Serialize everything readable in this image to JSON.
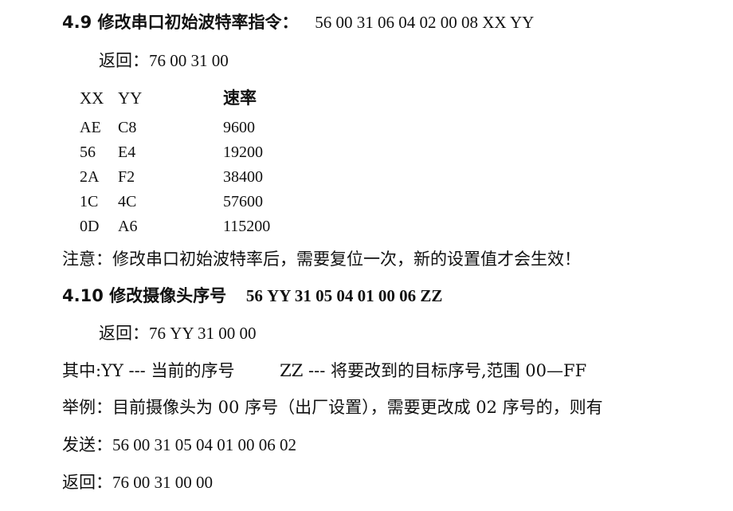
{
  "s49": {
    "title": "4.9 修改串口初始波特率指令：",
    "cmd": "56 00 31 06 04 02 00 08 XX  YY",
    "return_label": "返回：",
    "return_val": "76 00 31 00",
    "table": {
      "headers": [
        "XX",
        "YY",
        "速率"
      ],
      "rows": [
        [
          "AE",
          "C8",
          "9600"
        ],
        [
          "56",
          "E4",
          "19200"
        ],
        [
          "2A",
          "F2",
          "38400"
        ],
        [
          "1C",
          "4C",
          "57600"
        ],
        [
          "0D",
          "A6",
          "115200"
        ]
      ]
    },
    "note": "注意：修改串口初始波特率后，需要复位一次，新的设置值才会生效！"
  },
  "s410": {
    "title": "4.10 修改摄像头序号",
    "cmd": "56 YY 31 05 04 01 00 06 ZZ",
    "return_label": "返回：",
    "return_val": "76 YY 31 00 00",
    "explain_a": "其中:YY  --- 当前的序号",
    "explain_b": "ZZ  --- 将要改到的目标序号,范围 00—FF",
    "example": "举例：目前摄像头为 00 序号（出厂设置），需要更改成 02 序号的，则有",
    "send_label": "发送：",
    "send_val": "56 00 31 05 04 01 00 06 02",
    "ret2_label": "返回：",
    "ret2_val": "76 00 31 00 00"
  }
}
